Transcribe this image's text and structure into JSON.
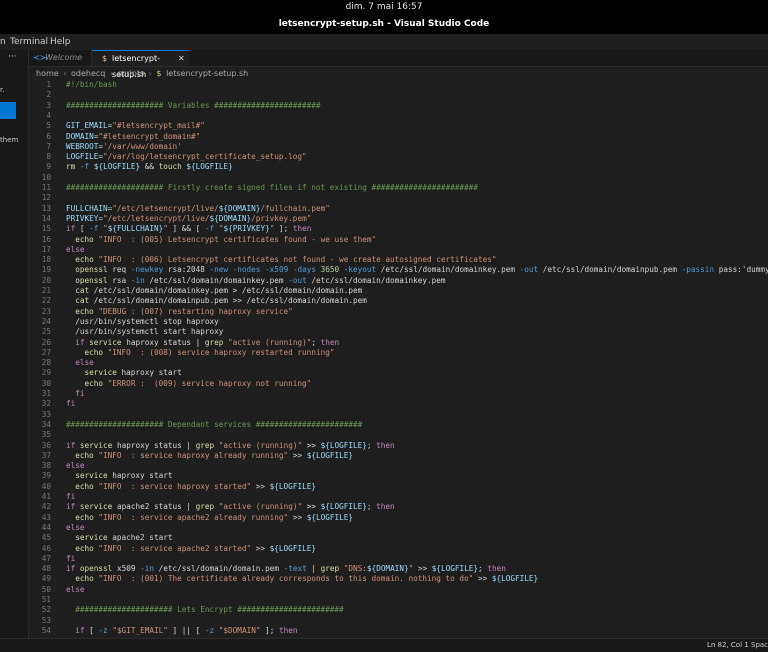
{
  "topbar": {
    "clock": "dim. 7 mai  16:57"
  },
  "window": {
    "title": "letsencrypt-setup.sh - Visual Studio Code"
  },
  "menubar": {
    "items": [
      "n",
      "Terminal",
      "Help"
    ]
  },
  "left_panel": {
    "dots": "···",
    "fragment_r": "r.",
    "fragment_them": "them"
  },
  "tabs": [
    {
      "label": "Welcome",
      "icon": "vscode-icon",
      "active": false
    },
    {
      "label": "letsencrypt-setup.sh",
      "icon": "dollar-shell-icon",
      "active": true,
      "close": "✕"
    }
  ],
  "breadcrumb": [
    "home",
    "odehecq",
    "scripts",
    "letsencrypt-setup.sh"
  ],
  "breadcrumb_sep": "›",
  "editor": {
    "lines": [
      {
        "n": "1",
        "t": [
          [
            "#!/bin/bash",
            "com"
          ]
        ]
      },
      {
        "n": "2",
        "t": []
      },
      {
        "n": "3",
        "t": [
          [
            "##################### Variables #######################",
            "com"
          ]
        ]
      },
      {
        "n": "4",
        "t": []
      },
      {
        "n": "5",
        "t": [
          [
            "GIT_EMAIL",
            "var"
          ],
          [
            "=",
            "op"
          ],
          [
            "\"#letsencrypt_mail#\"",
            "str"
          ]
        ]
      },
      {
        "n": "6",
        "t": [
          [
            "DOMAIN",
            "var"
          ],
          [
            "=",
            "op"
          ],
          [
            "\"#letsencrypt_domain#\"",
            "str"
          ]
        ]
      },
      {
        "n": "7",
        "t": [
          [
            "WEBROOT",
            "var"
          ],
          [
            "=",
            "op"
          ],
          [
            "'/var/www/domain'",
            "str"
          ]
        ]
      },
      {
        "n": "8",
        "t": [
          [
            "LOGFILE",
            "var"
          ],
          [
            "=",
            "op"
          ],
          [
            "\"/var/log/letsencrypt_certificate_setup.log\"",
            "str"
          ]
        ]
      },
      {
        "n": "9",
        "t": [
          [
            "rm",
            "cmd"
          ],
          [
            " ",
            "op"
          ],
          [
            "-f",
            "opt"
          ],
          [
            " ",
            "op"
          ],
          [
            "${LOGFILE}",
            "var"
          ],
          [
            " && ",
            "op"
          ],
          [
            "touch",
            "cmd"
          ],
          [
            " ",
            "op"
          ],
          [
            "${LOGFILE}",
            "var"
          ]
        ]
      },
      {
        "n": "10",
        "t": []
      },
      {
        "n": "11",
        "t": [
          [
            "##################### Firstly create signed files if not existing #######################",
            "com"
          ]
        ]
      },
      {
        "n": "12",
        "t": []
      },
      {
        "n": "13",
        "t": [
          [
            "FULLCHAIN",
            "var"
          ],
          [
            "=",
            "op"
          ],
          [
            "\"/etc/letsencrypt/live/",
            "str"
          ],
          [
            "${DOMAIN}",
            "var"
          ],
          [
            "/fullchain.pem\"",
            "str"
          ]
        ]
      },
      {
        "n": "14",
        "t": [
          [
            "PRIVKEY",
            "var"
          ],
          [
            "=",
            "op"
          ],
          [
            "\"/etc/letsencrypt/live/",
            "str"
          ],
          [
            "${DOMAIN}",
            "var"
          ],
          [
            "/privkey.pem\"",
            "str"
          ]
        ]
      },
      {
        "n": "15",
        "t": [
          [
            "if",
            "kw"
          ],
          [
            " [ ",
            "op"
          ],
          [
            "-f",
            "opt"
          ],
          [
            " ",
            "op"
          ],
          [
            "\"",
            "str"
          ],
          [
            "${FULLCHAIN}",
            "var"
          ],
          [
            "\"",
            "str"
          ],
          [
            " ] && [ ",
            "op"
          ],
          [
            "-f",
            "opt"
          ],
          [
            " ",
            "op"
          ],
          [
            "\"",
            "str"
          ],
          [
            "${PRIVKEY}",
            "var"
          ],
          [
            "\"",
            "str"
          ],
          [
            " ]; ",
            "op"
          ],
          [
            "then",
            "kw"
          ]
        ]
      },
      {
        "n": "16",
        "t": [
          [
            "  echo",
            "cmd"
          ],
          [
            " ",
            "op"
          ],
          [
            "\"INFO  : (005) Letsencrypt certificates found - we use them\"",
            "str"
          ]
        ]
      },
      {
        "n": "17",
        "t": [
          [
            "else",
            "kw"
          ]
        ]
      },
      {
        "n": "18",
        "t": [
          [
            "  echo",
            "cmd"
          ],
          [
            " ",
            "op"
          ],
          [
            "\"INFO  : (006) Letsencrypt certificates not found - we create autosigned certificates\"",
            "str"
          ]
        ]
      },
      {
        "n": "19",
        "t": [
          [
            "  openssl",
            "cmd"
          ],
          [
            " req ",
            "op"
          ],
          [
            "-newkey",
            "opt"
          ],
          [
            " rsa:2048 ",
            "op"
          ],
          [
            "-new -nodes -x509 -days",
            "opt"
          ],
          [
            " ",
            "op"
          ],
          [
            "3650",
            "num"
          ],
          [
            " ",
            "op"
          ],
          [
            "-keyout",
            "opt"
          ],
          [
            " /etc/ssl/domain/domainkey.pem ",
            "op"
          ],
          [
            "-out",
            "opt"
          ],
          [
            " /etc/ssl/domain/domainpub.pem ",
            "op"
          ],
          [
            "-passin",
            "opt"
          ],
          [
            " pass:'dummypa",
            "op"
          ]
        ]
      },
      {
        "n": "20",
        "t": [
          [
            "  openssl",
            "cmd"
          ],
          [
            " rsa ",
            "op"
          ],
          [
            "-in",
            "opt"
          ],
          [
            " /etc/ssl/domain/domainkey.pem ",
            "op"
          ],
          [
            "-out",
            "opt"
          ],
          [
            " /etc/ssl/domain/domainkey.pem",
            "op"
          ]
        ]
      },
      {
        "n": "21",
        "t": [
          [
            "  cat",
            "cmd"
          ],
          [
            " /etc/ssl/domain/domainkey.pem > /etc/ssl/domain/domain.pem",
            "op"
          ]
        ]
      },
      {
        "n": "22",
        "t": [
          [
            "  cat",
            "cmd"
          ],
          [
            " /etc/ssl/domain/domainpub.pem >> /etc/ssl/domain/domain.pem",
            "op"
          ]
        ]
      },
      {
        "n": "23",
        "t": [
          [
            "  echo",
            "cmd"
          ],
          [
            " ",
            "op"
          ],
          [
            "\"DEBUG : (007) restarting haproxy service\"",
            "str"
          ]
        ]
      },
      {
        "n": "24",
        "t": [
          [
            "  /usr/bin/systemctl stop haproxy",
            "op"
          ]
        ]
      },
      {
        "n": "25",
        "t": [
          [
            "  /usr/bin/systemctl start haproxy",
            "op"
          ]
        ]
      },
      {
        "n": "26",
        "t": [
          [
            "  if",
            "kw"
          ],
          [
            " ",
            "op"
          ],
          [
            "service",
            "cmd"
          ],
          [
            " haproxy status | ",
            "op"
          ],
          [
            "grep",
            "cmd"
          ],
          [
            " ",
            "op"
          ],
          [
            "\"active (running)\"",
            "str"
          ],
          [
            "; ",
            "op"
          ],
          [
            "then",
            "kw"
          ]
        ]
      },
      {
        "n": "27",
        "t": [
          [
            "    echo",
            "cmd"
          ],
          [
            " ",
            "op"
          ],
          [
            "\"INFO  : (008) service haproxy restarted running\"",
            "str"
          ]
        ]
      },
      {
        "n": "28",
        "t": [
          [
            "  else",
            "kw"
          ]
        ]
      },
      {
        "n": "29",
        "t": [
          [
            "    service",
            "cmd"
          ],
          [
            " haproxy start",
            "op"
          ]
        ]
      },
      {
        "n": "30",
        "t": [
          [
            "    echo",
            "cmd"
          ],
          [
            " ",
            "op"
          ],
          [
            "\"ERROR :  (009) service haproxy not running\"",
            "str"
          ]
        ]
      },
      {
        "n": "31",
        "t": [
          [
            "  fi",
            "kw"
          ]
        ]
      },
      {
        "n": "32",
        "t": [
          [
            "fi",
            "kw"
          ]
        ]
      },
      {
        "n": "33",
        "t": []
      },
      {
        "n": "34",
        "t": [
          [
            "##################### Dependant services #######################",
            "com"
          ]
        ]
      },
      {
        "n": "35",
        "t": []
      },
      {
        "n": "36",
        "t": [
          [
            "if",
            "kw"
          ],
          [
            " ",
            "op"
          ],
          [
            "service",
            "cmd"
          ],
          [
            " haproxy status | ",
            "op"
          ],
          [
            "grep",
            "cmd"
          ],
          [
            " ",
            "op"
          ],
          [
            "\"active (running)\"",
            "str"
          ],
          [
            " >> ",
            "op"
          ],
          [
            "${LOGFILE}",
            "var"
          ],
          [
            "; ",
            "op"
          ],
          [
            "then",
            "kw"
          ]
        ]
      },
      {
        "n": "37",
        "t": [
          [
            "  echo",
            "cmd"
          ],
          [
            " ",
            "op"
          ],
          [
            "\"INFO  : service haproxy already running\"",
            "str"
          ],
          [
            " >> ",
            "op"
          ],
          [
            "${LOGFILE}",
            "var"
          ]
        ]
      },
      {
        "n": "38",
        "t": [
          [
            "else",
            "kw"
          ]
        ]
      },
      {
        "n": "39",
        "t": [
          [
            "  service",
            "cmd"
          ],
          [
            " haproxy start",
            "op"
          ]
        ]
      },
      {
        "n": "40",
        "t": [
          [
            "  echo",
            "cmd"
          ],
          [
            " ",
            "op"
          ],
          [
            "\"INFO  : service haproxy started\"",
            "str"
          ],
          [
            " >> ",
            "op"
          ],
          [
            "${LOGFILE}",
            "var"
          ]
        ]
      },
      {
        "n": "41",
        "t": [
          [
            "fi",
            "kw"
          ]
        ]
      },
      {
        "n": "42",
        "t": [
          [
            "if",
            "kw"
          ],
          [
            " ",
            "op"
          ],
          [
            "service",
            "cmd"
          ],
          [
            " apache2 status | ",
            "op"
          ],
          [
            "grep",
            "cmd"
          ],
          [
            " ",
            "op"
          ],
          [
            "\"active (running)\"",
            "str"
          ],
          [
            " >> ",
            "op"
          ],
          [
            "${LOGFILE}",
            "var"
          ],
          [
            "; ",
            "op"
          ],
          [
            "then",
            "kw"
          ]
        ]
      },
      {
        "n": "43",
        "t": [
          [
            "  echo",
            "cmd"
          ],
          [
            " ",
            "op"
          ],
          [
            "\"INFO  : service apache2 already running\"",
            "str"
          ],
          [
            " >> ",
            "op"
          ],
          [
            "${LOGFILE}",
            "var"
          ]
        ]
      },
      {
        "n": "44",
        "t": [
          [
            "else",
            "kw"
          ]
        ]
      },
      {
        "n": "45",
        "t": [
          [
            "  service",
            "cmd"
          ],
          [
            " apache2 start",
            "op"
          ]
        ]
      },
      {
        "n": "46",
        "t": [
          [
            "  echo",
            "cmd"
          ],
          [
            " ",
            "op"
          ],
          [
            "\"INFO  : service apache2 started\"",
            "str"
          ],
          [
            " >> ",
            "op"
          ],
          [
            "${LOGFILE}",
            "var"
          ]
        ]
      },
      {
        "n": "47",
        "t": [
          [
            "fi",
            "kw"
          ]
        ]
      },
      {
        "n": "48",
        "t": [
          [
            "if",
            "kw"
          ],
          [
            " ",
            "op"
          ],
          [
            "openssl",
            "cmd"
          ],
          [
            " x509 ",
            "op"
          ],
          [
            "-in",
            "opt"
          ],
          [
            " /etc/ssl/domain/domain.pem ",
            "op"
          ],
          [
            "-text",
            "opt"
          ],
          [
            " | ",
            "op"
          ],
          [
            "grep",
            "cmd"
          ],
          [
            " ",
            "op"
          ],
          [
            "\"DNS:",
            "str"
          ],
          [
            "${DOMAIN}",
            "var"
          ],
          [
            "\"",
            "str"
          ],
          [
            " >> ",
            "op"
          ],
          [
            "${LOGFILE}",
            "var"
          ],
          [
            "; ",
            "op"
          ],
          [
            "then",
            "kw"
          ]
        ]
      },
      {
        "n": "49",
        "t": [
          [
            "  echo",
            "cmd"
          ],
          [
            " ",
            "op"
          ],
          [
            "\"INFO  : (001) The certificate already corresponds to this domain. nothing to do\"",
            "str"
          ],
          [
            " >> ",
            "op"
          ],
          [
            "${LOGFILE}",
            "var"
          ]
        ]
      },
      {
        "n": "50",
        "t": [
          [
            "else",
            "kw"
          ]
        ]
      },
      {
        "n": "51",
        "t": []
      },
      {
        "n": "52",
        "t": [
          [
            "  ##################### Lets Encrypt #######################",
            "com"
          ]
        ]
      },
      {
        "n": "53",
        "t": []
      },
      {
        "n": "54",
        "t": [
          [
            "  if",
            "kw"
          ],
          [
            " [ ",
            "op"
          ],
          [
            "-z",
            "opt"
          ],
          [
            " ",
            "op"
          ],
          [
            "\"$GIT_EMAIL\"",
            "str"
          ],
          [
            " ] || [ ",
            "op"
          ],
          [
            "-z",
            "opt"
          ],
          [
            " ",
            "op"
          ],
          [
            "\"$DOMAIN\"",
            "str"
          ],
          [
            " ]; ",
            "op"
          ],
          [
            "then",
            "kw"
          ]
        ]
      }
    ]
  },
  "statusbar": {
    "position": "Ln 82, Col 1",
    "spaces": "Space"
  },
  "colors": {
    "accent": "#0078d4",
    "comment": "#6a9955",
    "variable": "#9cdcfe",
    "string": "#ce9178",
    "keyword": "#c586c0",
    "command": "#dcdcaa",
    "option": "#569cd6",
    "number": "#b5cea8"
  }
}
